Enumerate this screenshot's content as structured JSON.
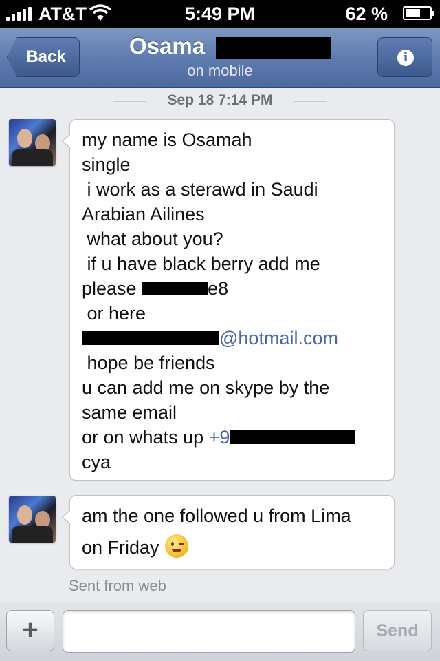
{
  "status_bar": {
    "carrier": "AT&T",
    "time": "5:49 PM",
    "battery_percent": "62 %",
    "battery_level": 0.62
  },
  "nav": {
    "back_label": "Back",
    "contact_name": "Osama",
    "status": "on mobile",
    "info_label": "i"
  },
  "conversation": {
    "timestamp": "Sep 18 7:14 PM",
    "messages": [
      {
        "lines": [
          "my name is Osamah",
          "single",
          " i work as a sterawd in Saudi",
          "Arabian Ailines",
          " what about you?",
          " if u have black berry add me",
          "please ",
          "e8",
          " or here",
          "@hotmail.com",
          " hope be friends",
          "u can add me on skype by the",
          "same email",
          "or on whats up ",
          "+9",
          "cya"
        ]
      },
      {
        "lines": [
          "am the one followed u from Lima",
          "on Friday"
        ],
        "emoji": "winking-face"
      }
    ],
    "footer": "Sent from web"
  },
  "composer": {
    "plus_label": "+",
    "input_value": "",
    "input_placeholder": "",
    "send_label": "Send"
  },
  "colors": {
    "nav_blue": "#5f7cb0",
    "link": "#4a68a6",
    "background": "#e9ebef"
  }
}
